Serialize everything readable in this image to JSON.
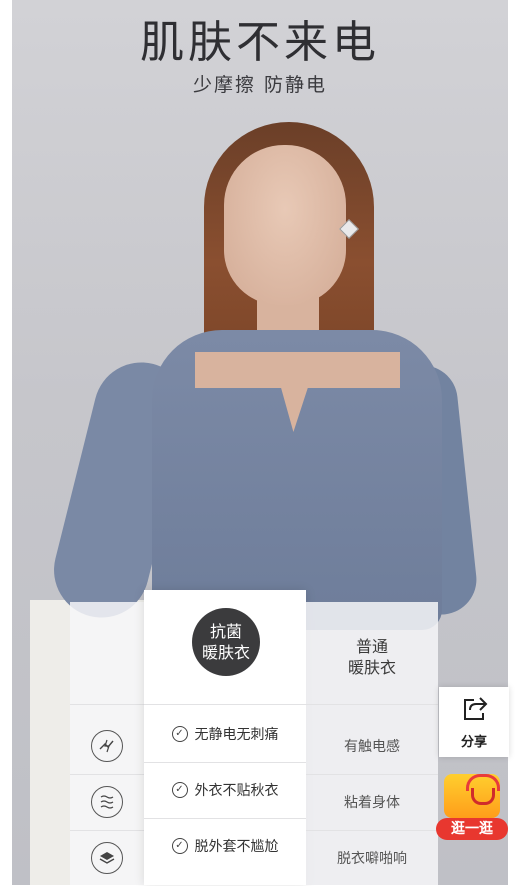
{
  "hero": {
    "title": "肌肤不来电",
    "subtitle": "少摩擦 防静电"
  },
  "comparison": {
    "ours_header_line1": "抗菌",
    "ours_header_line2": "暖肤衣",
    "other_header_line1": "普通",
    "other_header_line2": "暖肤衣",
    "rows": [
      {
        "icon": "static-electricity-icon",
        "ours": "无静电无刺痛",
        "other": "有触电感"
      },
      {
        "icon": "layers-wave-icon",
        "ours": "外衣不贴秋衣",
        "other": "粘着身体"
      },
      {
        "icon": "stacked-layers-icon",
        "ours": "脱外套不尴尬",
        "other": "脱衣噼啪响"
      }
    ]
  },
  "widgets": {
    "share_label": "分享",
    "stroll_label": "逛一逛"
  }
}
